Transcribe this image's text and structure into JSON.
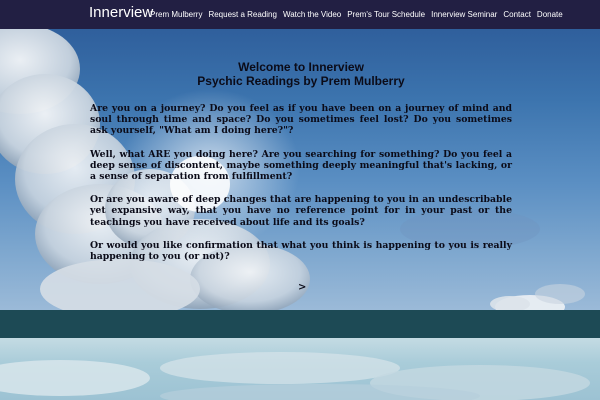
{
  "brand": "Innerview",
  "nav": [
    "Prem Mulberry",
    "Request a Reading",
    "Watch the Video",
    "Prem's Tour Schedule",
    "Innerview Seminar",
    "Contact",
    "Donate"
  ],
  "hero": {
    "title_line1": "Welcome to Innerview",
    "title_line2": "Psychic Readings by Prem Mulberry",
    "paragraphs": [
      "Are you on a journey?   Do you feel as if you have been on a journey of mind and soul through time and space?   Do you sometimes feel lost?   Do you sometimes ask yourself, \"What am I doing here?\"?",
      "Well, what ARE you doing here?   Are you searching for something?   Do you feel a deep sense of discontent, maybe something deeply meaningful that's lacking, or a sense of separation from fulfillment?",
      "Or are you aware of deep changes that are happening to you in an undescribable yet expansive way, that you have no reference point for in your past or the teachings you have received about life and its goals?",
      "Or would you like confirmation that what you think is happening to you is really happening to you (or not)?"
    ],
    "next_arrow": ">"
  },
  "colors": {
    "navbar": "#221f43",
    "band": "#1d4a55",
    "sky": "#3c74ae",
    "text": "#0b0b18"
  }
}
